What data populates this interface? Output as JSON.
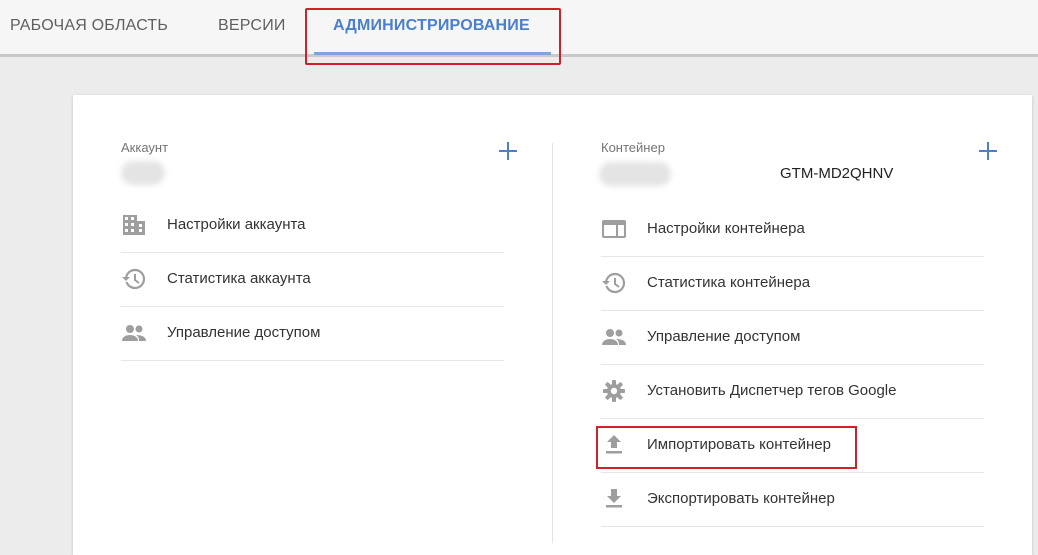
{
  "tabs": {
    "workspace": "РАБОЧАЯ ОБЛАСТЬ",
    "versions": "ВЕРСИИ",
    "admin": "АДМИНИСТРИРОВАНИЕ"
  },
  "account": {
    "label": "Аккаунт",
    "items": [
      {
        "label": "Настройки аккаунта",
        "icon": "building-icon"
      },
      {
        "label": "Статистика аккаунта",
        "icon": "history-icon"
      },
      {
        "label": "Управление доступом",
        "icon": "people-icon"
      }
    ]
  },
  "container": {
    "label": "Контейнер",
    "id": "GTM-MD2QHNV",
    "items": [
      {
        "label": "Настройки контейнера",
        "icon": "window-icon"
      },
      {
        "label": "Статистика контейнера",
        "icon": "history-icon"
      },
      {
        "label": "Управление доступом",
        "icon": "people-icon"
      },
      {
        "label": "Установить Диспетчер тегов Google",
        "icon": "gear-icon"
      },
      {
        "label": "Импортировать контейнер",
        "icon": "upload-icon"
      },
      {
        "label": "Экспортировать контейнер",
        "icon": "download-icon"
      }
    ]
  },
  "colors": {
    "accent": "#4a7ed0",
    "highlight": "#d0202a",
    "icon": "#9e9e9e"
  }
}
